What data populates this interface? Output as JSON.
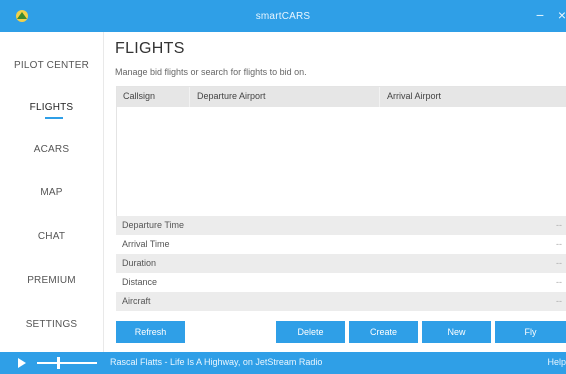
{
  "app": {
    "title": "smartCARS"
  },
  "sidebar": {
    "items": [
      {
        "label": "PILOT CENTER"
      },
      {
        "label": "FLIGHTS"
      },
      {
        "label": "ACARS"
      },
      {
        "label": "MAP"
      },
      {
        "label": "CHAT"
      },
      {
        "label": "PREMIUM"
      },
      {
        "label": "SETTINGS"
      }
    ],
    "active_label": "FLIGHTS"
  },
  "main": {
    "heading": "FLIGHTS",
    "subtitle": "Manage bid flights or search for flights to bid on.",
    "table": {
      "columns": [
        "Callsign",
        "Departure Airport",
        "Arrival Airport"
      ],
      "rows": []
    },
    "details": [
      {
        "label": "Departure Time",
        "value": "--"
      },
      {
        "label": "Arrival Time",
        "value": "--"
      },
      {
        "label": "Duration",
        "value": "--"
      },
      {
        "label": "Distance",
        "value": "--"
      },
      {
        "label": "Aircraft",
        "value": "--"
      }
    ],
    "buttons": {
      "refresh": "Refresh",
      "delete": "Delete",
      "create": "Create",
      "new": "New",
      "fly": "Fly"
    }
  },
  "footer": {
    "now_playing": "Rascal Flatts - Life Is A Highway, on JetStream Radio",
    "help": "Help"
  },
  "colors": {
    "accent": "#2f9fe7",
    "background": "#7fd36a"
  },
  "icons": {
    "logo": "smartcars-logo",
    "minimize": "minimize-icon",
    "close": "close-icon",
    "play": "play-icon"
  }
}
